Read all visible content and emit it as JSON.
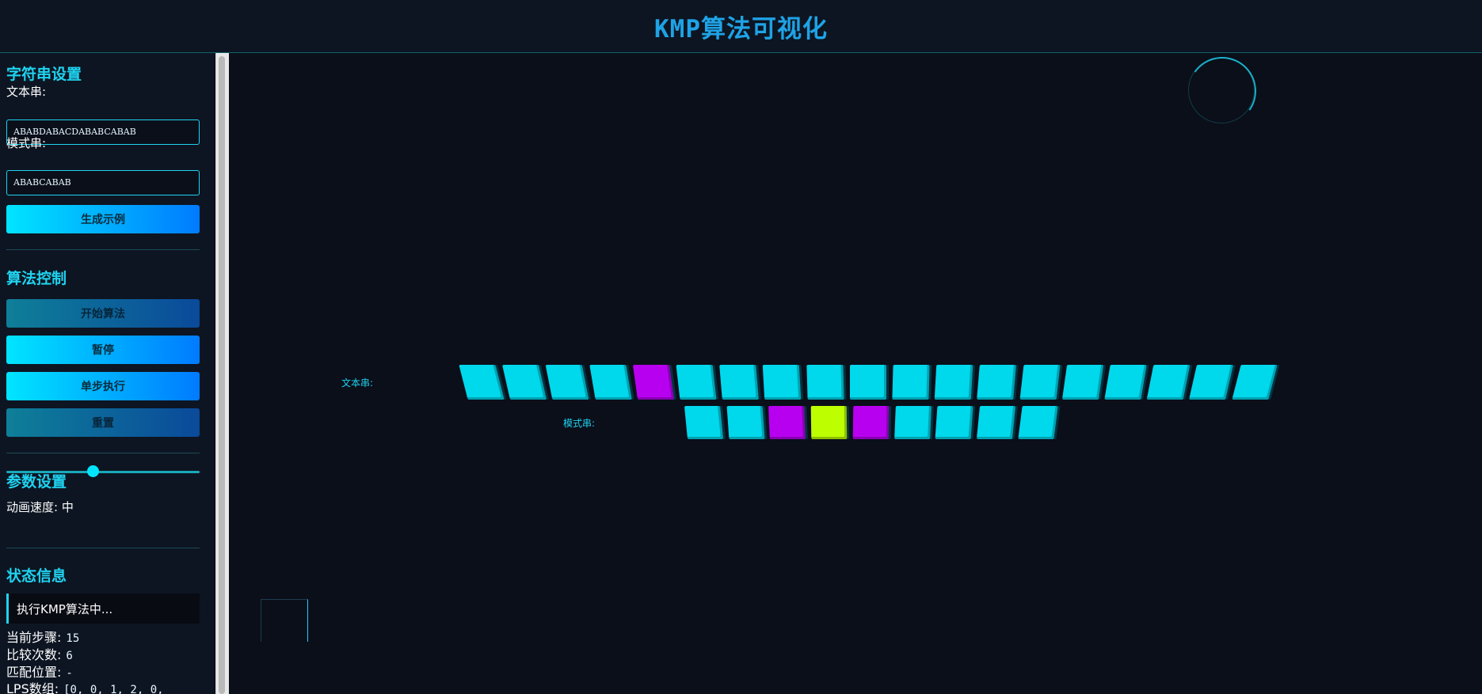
{
  "header": {
    "title": "KMP算法可视化"
  },
  "sidebar": {
    "string_settings": {
      "title": "字符串设置",
      "text_label": "文本串:",
      "text_value": "ABABDABACDABABCABAB",
      "pattern_label": "模式串:",
      "pattern_value": "ABABCABAB",
      "generate_button": "生成示例"
    },
    "algo_control": {
      "title": "算法控制",
      "start_button": "开始算法",
      "pause_button": "暂停",
      "step_button": "单步执行",
      "reset_button": "重置"
    },
    "params": {
      "title": "参数设置",
      "speed_label": "动画速度:",
      "speed_value": "中",
      "speed_level": 0.45
    },
    "status": {
      "title": "状态信息",
      "message": "执行KMP算法中...",
      "step_label": "当前步骤:",
      "step_value": "15",
      "compare_label": "比较次数:",
      "compare_value": "6",
      "match_label": "匹配位置:",
      "match_value": "-",
      "lps_label": "LPS数组:",
      "lps_value": "[0, 0, 1, 2, 0,"
    }
  },
  "visualization": {
    "text_row_label": "文本串:",
    "pattern_row_label": "模式串:",
    "colors": {
      "default": "#00d8ec",
      "mismatch": "#b800f0",
      "current": "#bdff00"
    },
    "text_cells": [
      "default",
      "default",
      "default",
      "default",
      "mismatch",
      "default",
      "default",
      "default",
      "default",
      "default",
      "default",
      "default",
      "default",
      "default",
      "default",
      "default",
      "default",
      "default",
      "default"
    ],
    "pattern_cells": [
      "default",
      "default",
      "mismatch",
      "current",
      "mismatch",
      "default",
      "default",
      "default",
      "default"
    ]
  }
}
